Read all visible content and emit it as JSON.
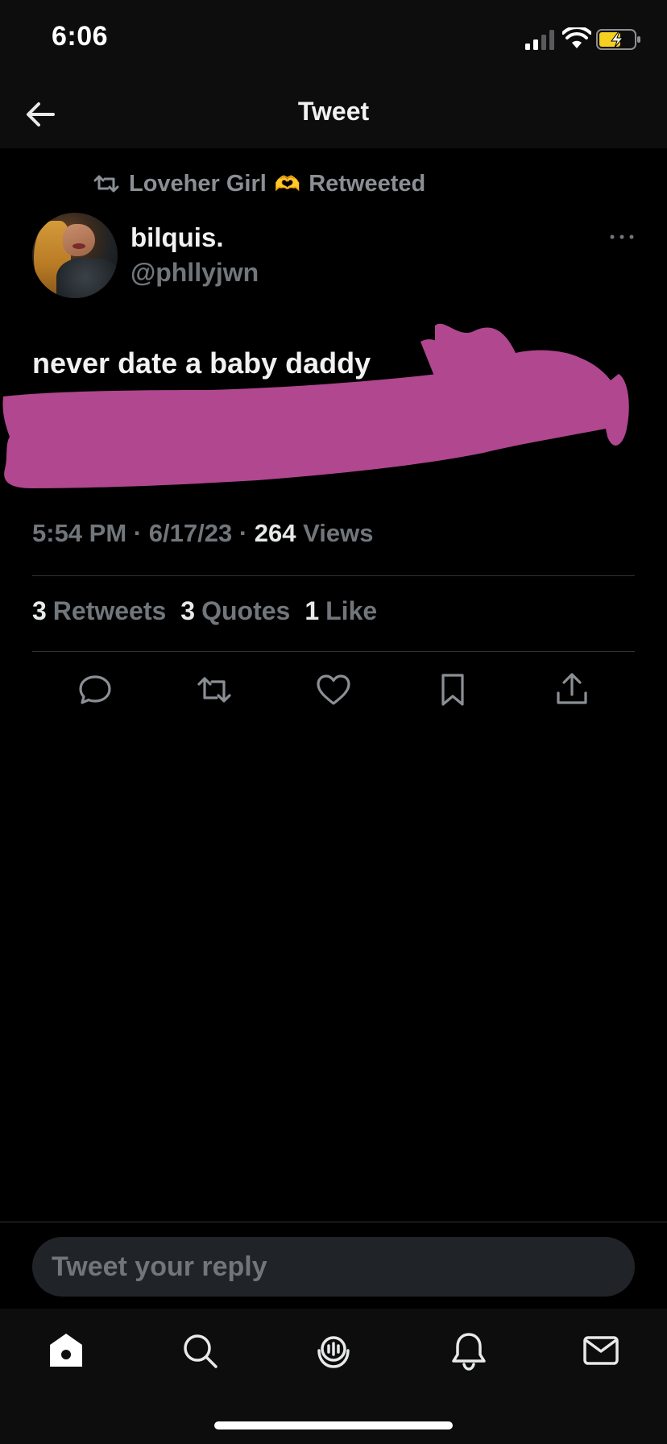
{
  "status_bar": {
    "time": "6:06",
    "signal_icon": "cellular-signal-icon",
    "wifi_icon": "wifi-icon",
    "battery_icon": "battery-charging-icon",
    "battery_color": "#f5d020"
  },
  "header": {
    "title": "Tweet",
    "back_icon": "back-arrow-icon"
  },
  "retweet_context": {
    "icon": "retweet-icon",
    "user": "Loveher Girl",
    "emoji": "🫶",
    "label": "Retweeted"
  },
  "tweet": {
    "author_name": "bilquis.",
    "author_handle": "@phllyjwn",
    "more_icon": "more-dots-icon",
    "text": "never date a baby daddy",
    "redaction_color": "#b0478f",
    "time": "5:54 PM",
    "separator": "·",
    "date": "6/17/23",
    "views_count": "264",
    "views_label": "Views"
  },
  "stats": {
    "retweets_count": "3",
    "retweets_label": "Retweets",
    "quotes_count": "3",
    "quotes_label": "Quotes",
    "likes_count": "1",
    "likes_label": "Like"
  },
  "actions": [
    "reply-icon",
    "retweet-icon",
    "like-heart-icon",
    "bookmark-icon",
    "share-icon"
  ],
  "reply": {
    "placeholder": "Tweet your reply"
  },
  "tab_bar": [
    "home-icon",
    "search-icon",
    "spaces-icon",
    "notifications-bell-icon",
    "messages-envelope-icon"
  ],
  "colors": {
    "background": "#000000",
    "text_primary": "#e7e9ea",
    "text_secondary": "#71767b",
    "divider": "#2f3336"
  }
}
